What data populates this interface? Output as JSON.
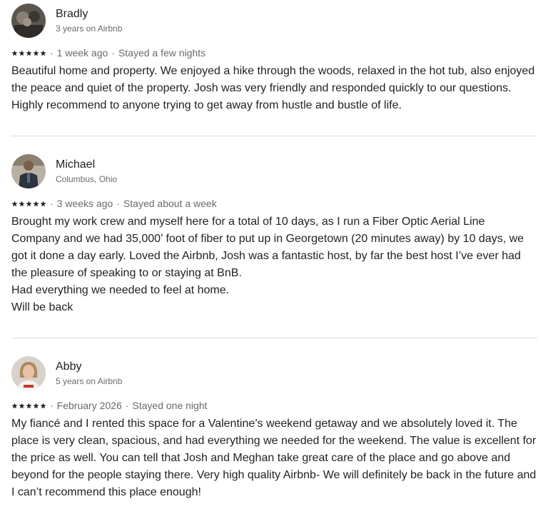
{
  "reviews": [
    {
      "name": "Bradly",
      "subtitle": "3 years on Airbnb",
      "rating": 5,
      "date": "1 week ago",
      "stay": "Stayed a few nights",
      "paragraphs": [
        "Beautiful home and property. We enjoyed a hike through the woods, relaxed in the hot tub, also enjoyed the peace and quiet of the property. Josh was very friendly and responded quickly to our questions. Highly recommend to anyone trying to get away from hustle and bustle of life."
      ]
    },
    {
      "name": "Michael",
      "subtitle": "Columbus, Ohio",
      "rating": 5,
      "date": "3 weeks ago",
      "stay": "Stayed about a week",
      "paragraphs": [
        "Brought my work crew and myself here for a total of 10 days, as I run a Fiber Optic Aerial Line Company and we had 35,000’ foot of fiber to put up in Georgetown (20 minutes away) by 10 days, we got it done a day early. Loved the Airbnb, Josh was a fantastic host, by far the best host I’ve ever had the pleasure of speaking to or staying at BnB.",
        "Had everything we needed to feel at home.",
        "Will be back"
      ]
    },
    {
      "name": "Abby",
      "subtitle": "5 years on Airbnb",
      "rating": 5,
      "date": "February 2026",
      "stay": "Stayed one night",
      "paragraphs": [
        "My fiancé and I rented this space for a Valentine’s weekend getaway and we absolutely loved it. The place is very clean, spacious, and had everything we needed for the weekend. The value is excellent for the price as well. You can tell that Josh and Meghan take great care of the place and go above and beyond for the people staying there. Very high quality Airbnb- We will definitely be back in the future and I can’t recommend this place enough!"
      ]
    }
  ],
  "separator": "·",
  "colors": {
    "text": "#222222",
    "muted": "#6a6a6a",
    "divider": "#dddddd",
    "star": "#222222"
  },
  "icons": {
    "star": "star-icon",
    "avatar": "avatar"
  }
}
